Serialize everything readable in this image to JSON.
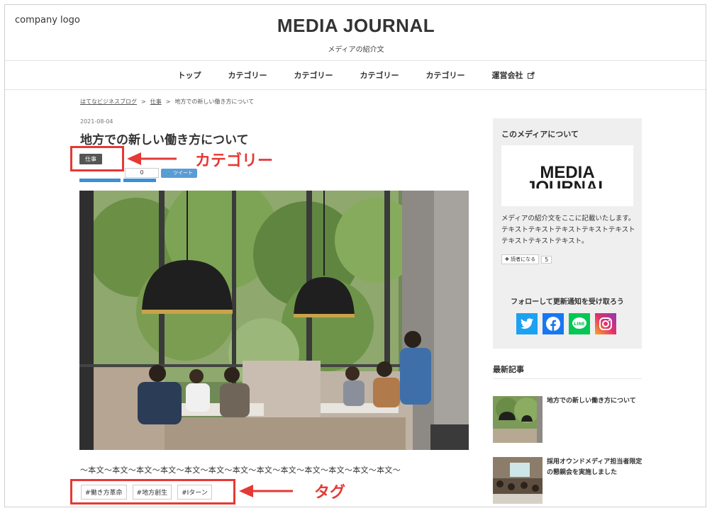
{
  "header": {
    "logo": "company logo",
    "title": "MEDIA JOURNAL",
    "subtitle": "メディアの紹介文"
  },
  "nav": {
    "items": [
      {
        "label": "トップ"
      },
      {
        "label": "カテゴリー"
      },
      {
        "label": "カテゴリー"
      },
      {
        "label": "カテゴリー"
      },
      {
        "label": "カテゴリー"
      },
      {
        "label": "運営会社"
      }
    ]
  },
  "breadcrumb": {
    "items": [
      "はてなビジネスブログ",
      "仕事",
      "地方での新しい働き方について"
    ],
    "separator": ">"
  },
  "article": {
    "date": "2021-08-04",
    "title": "地方での新しい働き方について",
    "category": "仕事",
    "share_count": "0",
    "tweet_label": "ツイート",
    "body": "〜本文〜本文〜本文〜本文〜本文〜本文〜本文〜本文〜本文〜本文〜本文〜本文〜本文〜",
    "tags": [
      "#働き方革命",
      "#地方創生",
      "#Iターン"
    ]
  },
  "annotations": {
    "category_label": "カテゴリー",
    "tag_label": "タグ",
    "color": "#e53935"
  },
  "sidebar": {
    "about": {
      "title": "このメディアについて",
      "logo_text": "MEDIA JOURNAL",
      "description": "メディアの紹介文をここに記載いたします。テキストテキストテキストテキストテキストテキストテキストテキスト。",
      "reader_button": "読者になる",
      "reader_count": "5"
    },
    "follow": {
      "title": "フォローして更新通知を受け取ろう",
      "icons": [
        "twitter-icon",
        "facebook-icon",
        "line-icon",
        "instagram-icon"
      ]
    },
    "recent": {
      "title": "最新記事",
      "items": [
        {
          "title": "地方での新しい働き方について"
        },
        {
          "title": "採用オウンドメディア担当者限定の懇親会を実施しました"
        }
      ]
    }
  },
  "colors": {
    "twitter": "#1da1f2",
    "facebook": "#1877f2",
    "line": "#06c755",
    "share_blue": "#3d8fd6"
  }
}
